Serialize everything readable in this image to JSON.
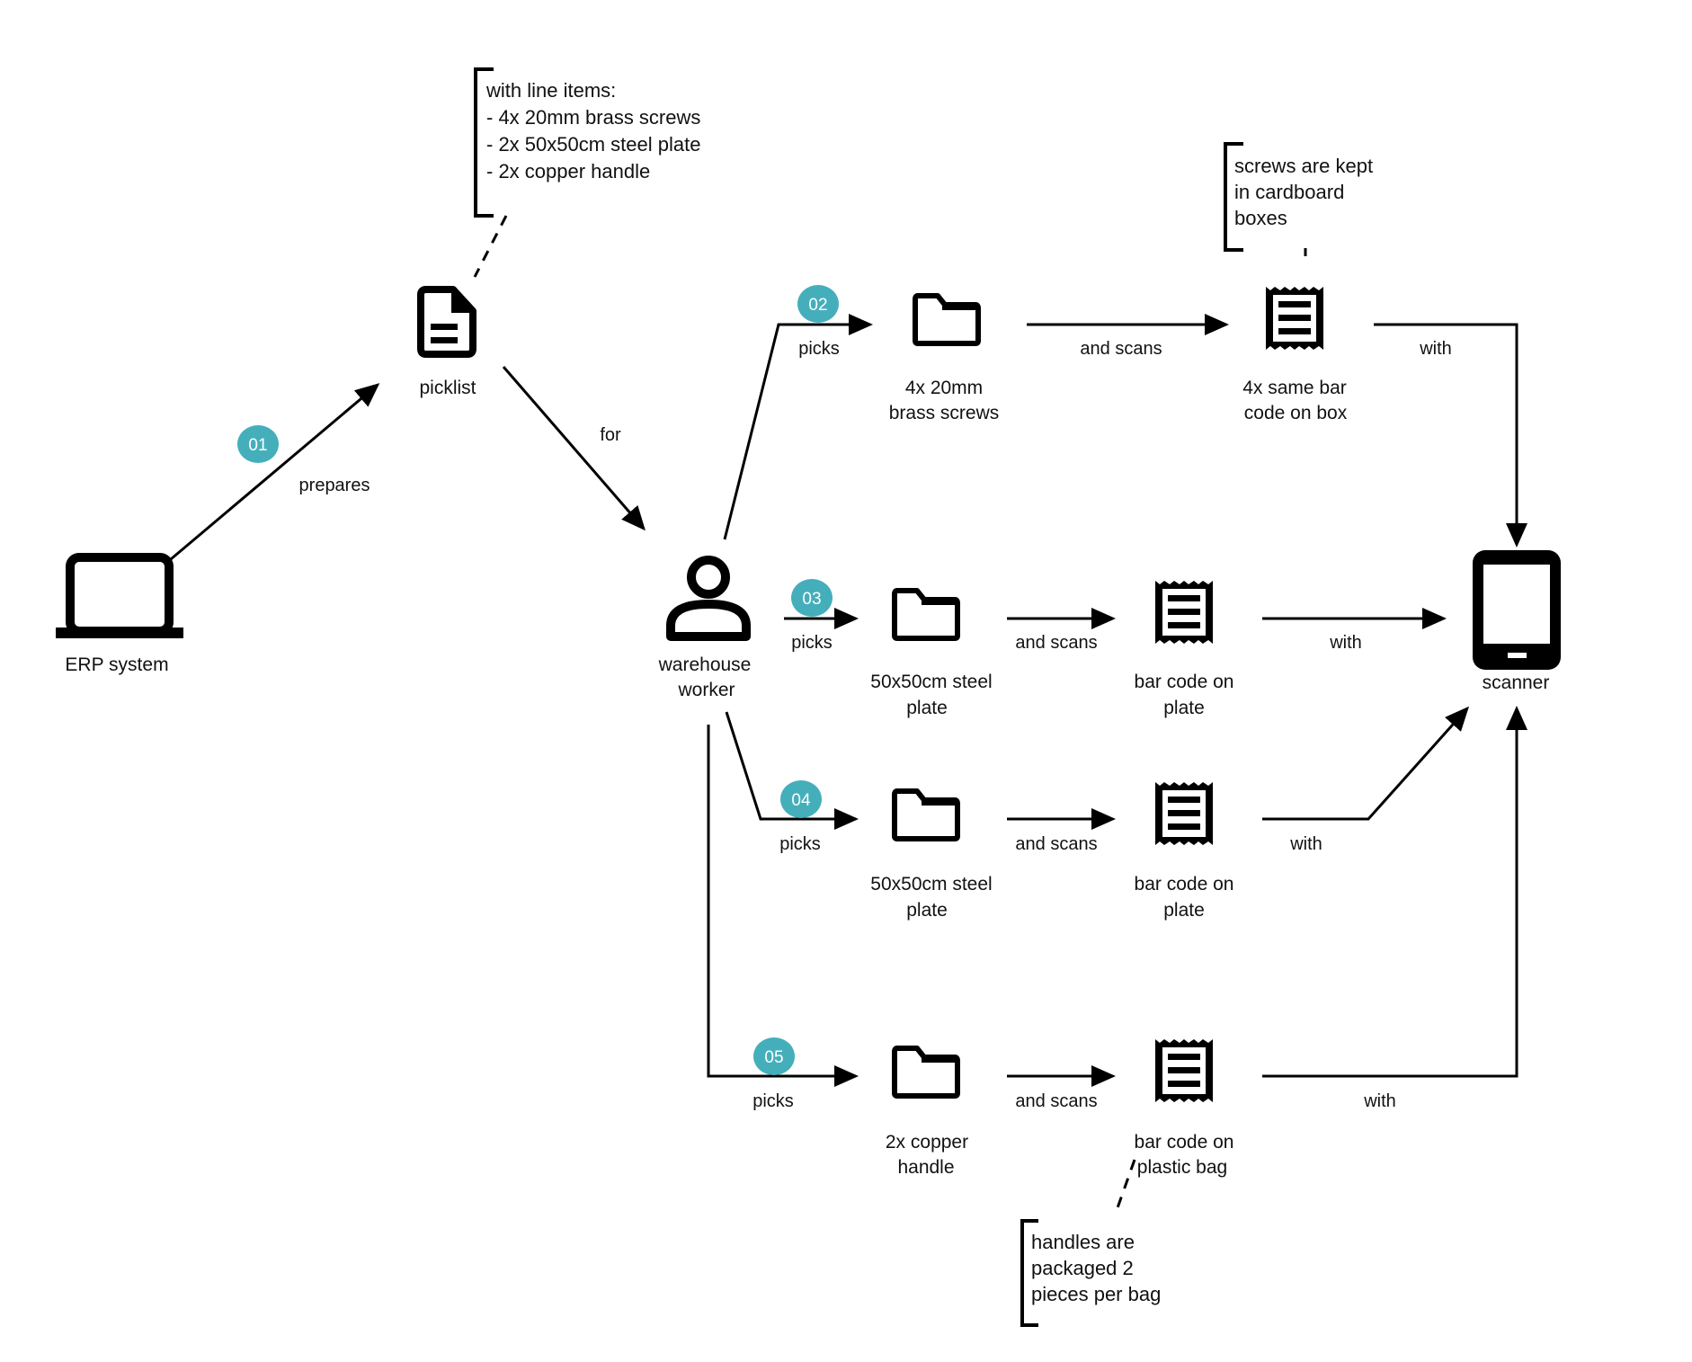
{
  "diagram": {
    "accent_color": "#44afbb",
    "nodes": {
      "erp": {
        "label": "ERP system",
        "icon": "laptop-icon"
      },
      "picklist": {
        "label": "picklist",
        "icon": "document-icon"
      },
      "worker": {
        "label_lines": [
          "warehouse",
          "worker"
        ],
        "icon": "person-icon"
      },
      "item_screws": {
        "label_lines": [
          "4x 20mm",
          "brass screws"
        ],
        "icon": "folder-icon"
      },
      "item_plate_1": {
        "label_lines": [
          "50x50cm steel",
          "plate"
        ],
        "icon": "folder-icon"
      },
      "item_plate_2": {
        "label_lines": [
          "50x50cm steel",
          "plate"
        ],
        "icon": "folder-icon"
      },
      "item_handle": {
        "label_lines": [
          "2x copper",
          "handle"
        ],
        "icon": "folder-icon"
      },
      "code_box": {
        "label_lines": [
          "4x same bar",
          "code on box"
        ],
        "icon": "receipt-icon"
      },
      "code_plate_1": {
        "label_lines": [
          "bar code on",
          "plate"
        ],
        "icon": "receipt-icon"
      },
      "code_plate_2": {
        "label_lines": [
          "bar code on",
          "plate"
        ],
        "icon": "receipt-icon"
      },
      "code_bag": {
        "label_lines": [
          "bar code on",
          "plastic bag"
        ],
        "icon": "receipt-icon"
      },
      "scanner": {
        "label": "scanner",
        "icon": "tablet-icon"
      }
    },
    "edges": {
      "prepares": "prepares",
      "for": "for",
      "picks_02": "picks",
      "picks_03": "picks",
      "picks_04": "picks",
      "picks_05": "picks",
      "scans_02": "and scans",
      "scans_03": "and scans",
      "scans_04": "and scans",
      "scans_05": "and scans",
      "with_02": "with",
      "with_03": "with",
      "with_04": "with",
      "with_05": "with"
    },
    "steps": [
      "01",
      "02",
      "03",
      "04",
      "05"
    ],
    "notes": {
      "picklist_items": [
        "with line items:",
        "- 4x 20mm brass screws",
        "- 2x 50x50cm steel plate",
        "- 2x copper handle"
      ],
      "screws": [
        "screws are kept",
        "in cardboard",
        "boxes"
      ],
      "handles": [
        "handles are",
        "packaged 2",
        "pieces per bag"
      ]
    }
  }
}
